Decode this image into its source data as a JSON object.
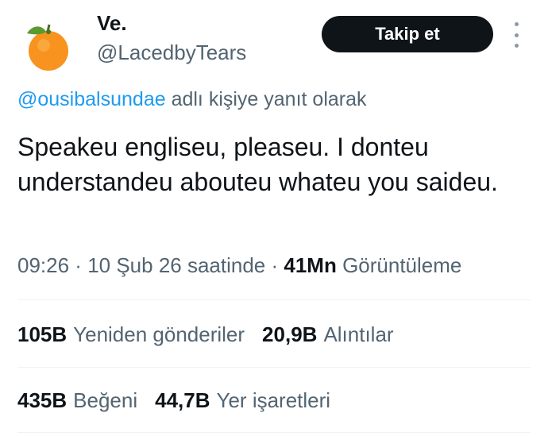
{
  "author": {
    "display_name": "Ve.",
    "handle": "@LacedbyTears",
    "avatar_icon": "tangerine-avatar"
  },
  "follow_label": "Takip et",
  "more_icon": "more-vertical-icon",
  "reply": {
    "mention": "@ousibalsundae",
    "suffix": " adlı kişiye yanıt olarak"
  },
  "tweet_text": "Speakeu engliseu, pleaseu. I donteu understandeu abouteu whateu you saideu.",
  "meta": {
    "time": "09:26",
    "sep1": " · ",
    "date": "10 Şub 26 saatinde",
    "sep2": " · ",
    "views_count": "41Mn",
    "views_label": " Görüntüleme"
  },
  "stats_row1": [
    {
      "count": "105B",
      "label": "Yeniden gönderiler"
    },
    {
      "count": "20,9B",
      "label": "Alıntılar"
    }
  ],
  "stats_row2": [
    {
      "count": "435B",
      "label": "Beğeni"
    },
    {
      "count": "44,7B",
      "label": "Yer işaretleri"
    }
  ],
  "colors": {
    "link": "#1d9bf0",
    "secondary_text": "#536471",
    "primary_text": "#0f1419",
    "button_bg": "#0f1419"
  }
}
